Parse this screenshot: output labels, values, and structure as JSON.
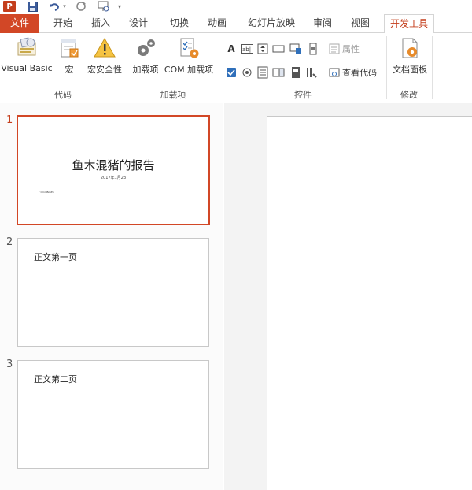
{
  "qat": {
    "app_logo": "P",
    "icons": [
      "powerpoint-logo",
      "save-icon",
      "undo-icon",
      "redo-icon",
      "present-icon",
      "customize-icon"
    ]
  },
  "tabs": [
    {
      "label": "文件"
    },
    {
      "label": "开始"
    },
    {
      "label": "插入"
    },
    {
      "label": "设计"
    },
    {
      "label": "切换"
    },
    {
      "label": "动画"
    },
    {
      "label": "幻灯片放映"
    },
    {
      "label": "审阅"
    },
    {
      "label": "视图"
    },
    {
      "label": "开发工具"
    }
  ],
  "active_tab": "开发工具",
  "ribbon": {
    "code": {
      "visual_basic": "Visual Basic",
      "macros": "宏",
      "macro_security": "宏安全性",
      "label": "代码"
    },
    "addins": {
      "addins": "加载项",
      "com_addins": "COM 加载项",
      "label": "加载项"
    },
    "controls": {
      "properties": "属性",
      "view_code": "查看代码",
      "label": "控件"
    },
    "modify": {
      "document_panel": "文档面板",
      "label": "修改"
    }
  },
  "slides": [
    {
      "number": "1",
      "title": "鱼木混猪的报告",
      "subtitle": "2017年1月23",
      "tiny": "* OmniBoxE1"
    },
    {
      "number": "2",
      "body": "正文第一页"
    },
    {
      "number": "3",
      "body": "正文第二页"
    }
  ],
  "colors": {
    "accent": "#d24726",
    "accent_text": "#c43e1c"
  }
}
